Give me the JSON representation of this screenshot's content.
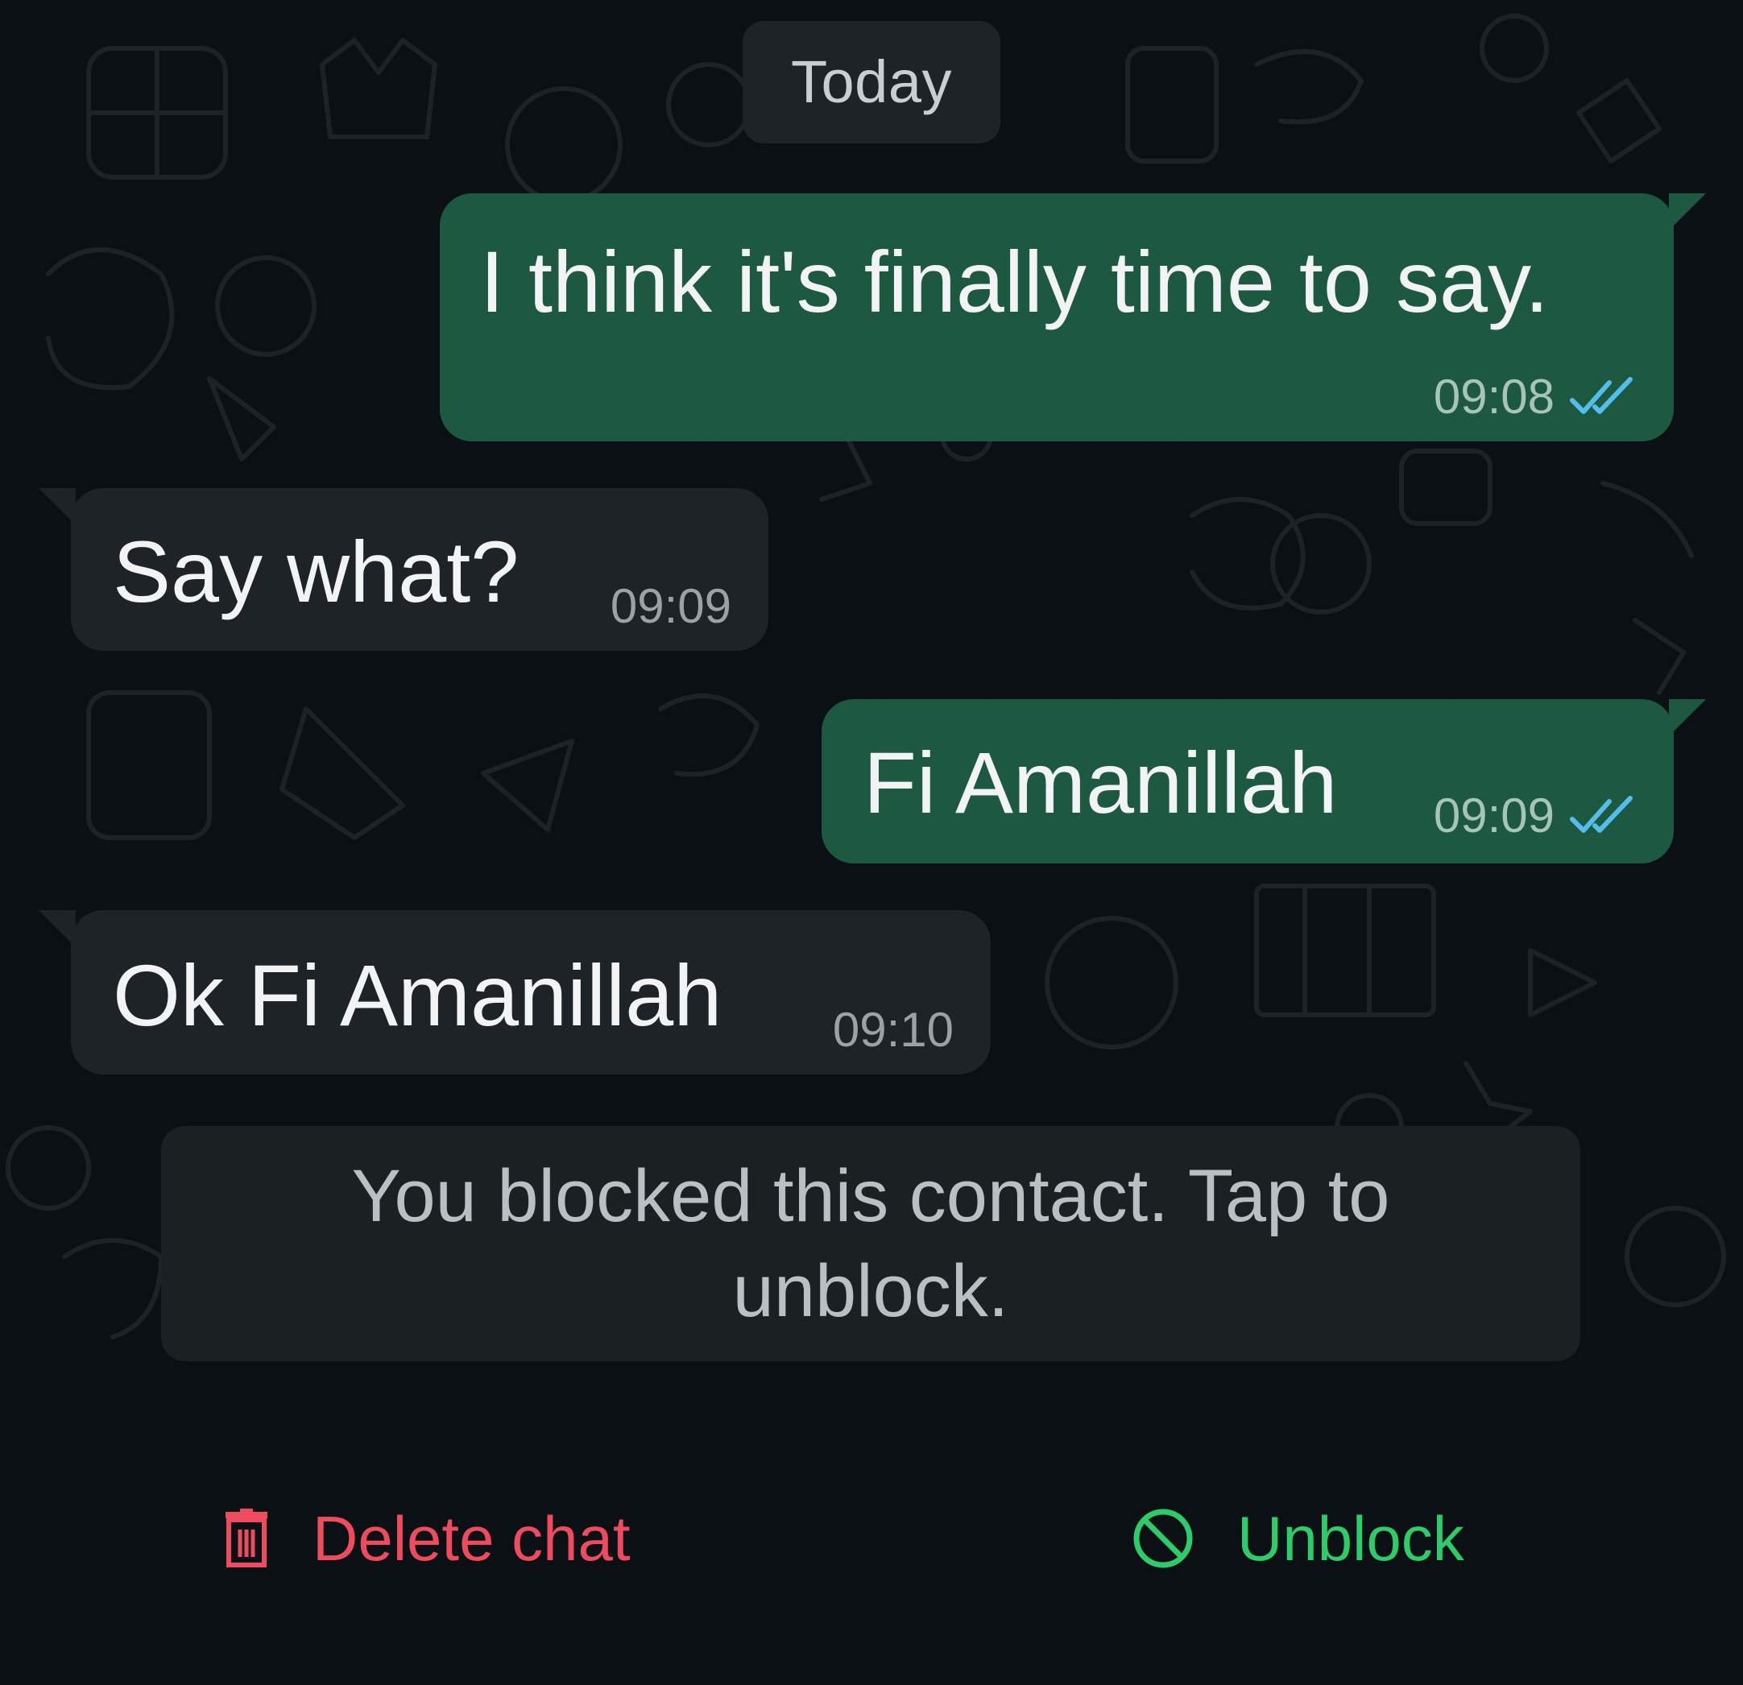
{
  "chat": {
    "date_divider": "Today",
    "messages": [
      {
        "direction": "outgoing",
        "text": "I think it's finally time to say.",
        "time": "09:08",
        "status_icon": "double-check-read-icon"
      },
      {
        "direction": "incoming",
        "text": "Say what?",
        "time": "09:09"
      },
      {
        "direction": "outgoing",
        "text": "Fi Amanillah",
        "time": "09:09",
        "status_icon": "double-check-read-icon"
      },
      {
        "direction": "incoming",
        "text": "Ok Fi Amanillah",
        "time": "09:10"
      }
    ],
    "system_notice": "You blocked this contact. Tap to unblock."
  },
  "actions": {
    "delete_label": "Delete chat",
    "delete_icon": "trash-icon",
    "unblock_label": "Unblock",
    "unblock_icon": "block-icon"
  },
  "colors": {
    "background": "#0b1014",
    "outgoing_bubble": "#1d5840",
    "incoming_bubble": "#1d2326",
    "read_ticks": "#53bdeb",
    "delete": "#ee4c5e",
    "unblock": "#2ecb6b"
  }
}
